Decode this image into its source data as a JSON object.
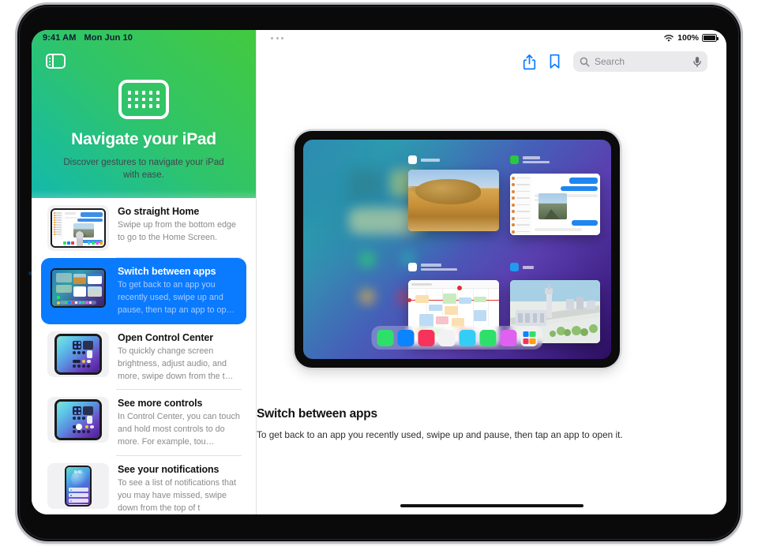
{
  "status_bar": {
    "time": "9:41 AM",
    "date": "Mon Jun 10",
    "battery_percent": "100%",
    "wifi_icon": "wifi-icon",
    "battery_icon": "battery-full-icon"
  },
  "sidebar": {
    "toggle_icon": "sidebar-toggle-icon",
    "hero": {
      "icon": "grid-keyboard-icon",
      "title": "Navigate your iPad",
      "subtitle": "Discover gestures to navigate your iPad with ease."
    },
    "items": [
      {
        "title": "Go straight Home",
        "desc": "Swipe up from the bottom edge to go to the Home Screen.",
        "thumb": "home-screen-thumbnail",
        "selected": false
      },
      {
        "title": "Switch between apps",
        "desc": "To get back to an app you recently used, swipe up and pause, then tap an app to op…",
        "thumb": "app-switcher-thumbnail",
        "selected": true
      },
      {
        "title": "Open Control Center",
        "desc": "To quickly change screen brightness, adjust audio, and more, swipe down from the t…",
        "thumb": "control-center-thumbnail",
        "selected": false
      },
      {
        "title": "See more controls",
        "desc": "In Control Center, you can touch and hold most controls to do more. For example, tou…",
        "thumb": "control-center-thumbnail",
        "selected": false
      },
      {
        "title": "See your notifications",
        "desc": "To see a list of notifications that you may have missed, swipe down from the top of t",
        "thumb": "notifications-thumbnail",
        "selected": false
      }
    ]
  },
  "toolbar": {
    "multitasking_icon": "multitasking-dots-icon",
    "share_icon": "share-icon",
    "bookmark_icon": "bookmark-icon",
    "search_placeholder": "Search",
    "search_value": "",
    "mic_icon": "microphone-icon",
    "accent_color": "#0a7aff"
  },
  "main": {
    "illustration": {
      "name": "app-switcher-illustration",
      "device": "ipad-landscape",
      "cards": [
        {
          "name": "photos-app-card",
          "badge_color": "#ffffff"
        },
        {
          "name": "mail-app-card",
          "badge_color": "#28c840"
        },
        {
          "name": "calendar-app-card",
          "badge_color": "#ffffff"
        },
        {
          "name": "maps-app-card",
          "badge_color": "#1f9cf0"
        }
      ],
      "dock_icons": [
        "#2ee06a",
        "#0a84ff",
        "#f5335b",
        "#f2f2f4",
        "#34cdf5",
        "#2ee06a",
        "#e060f0",
        "app-library-icon"
      ]
    },
    "caption_title": "Switch between apps",
    "caption_desc": "To get back to an app you recently used, swipe up and pause, then tap an app to open it."
  },
  "home_indicator": "home-indicator"
}
